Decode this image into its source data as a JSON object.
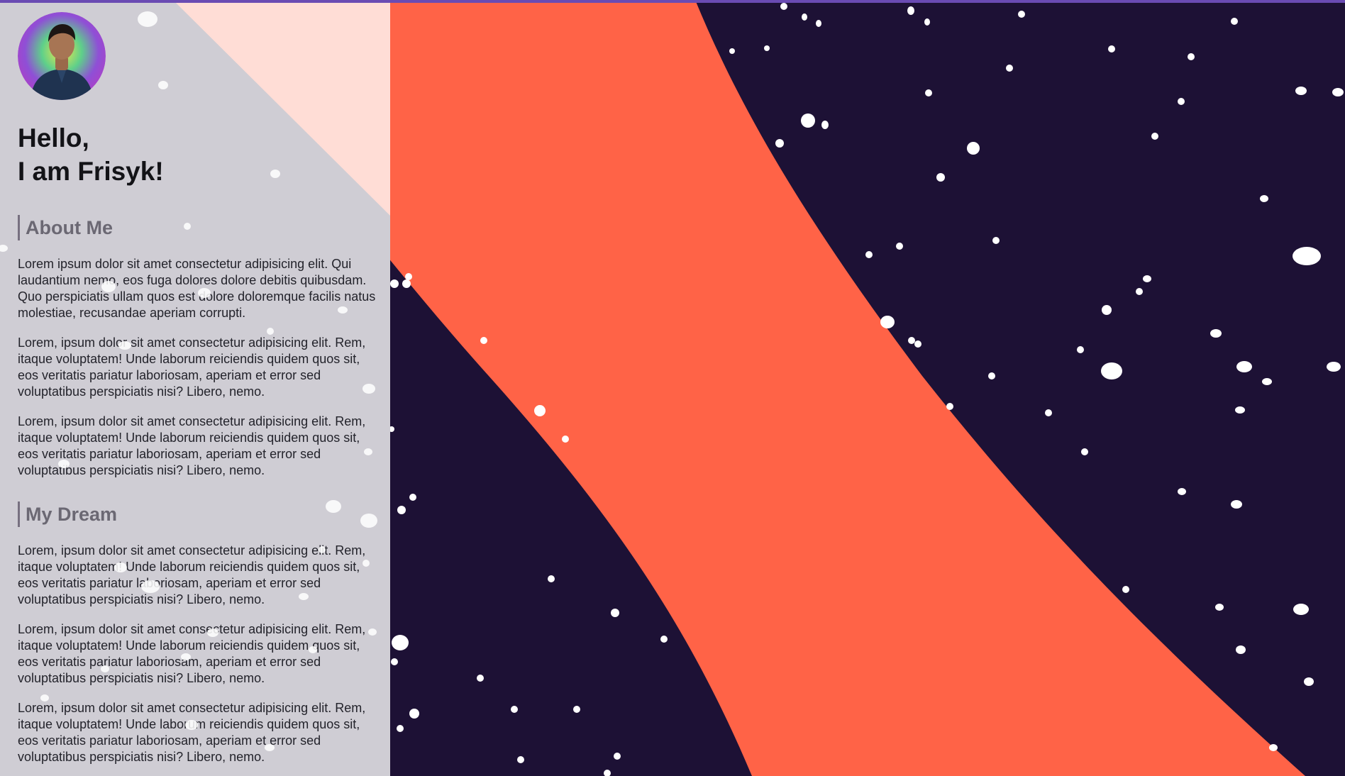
{
  "profile": {
    "greeting_line1": "Hello,",
    "greeting_line2": "I am Frisyk!"
  },
  "sections": [
    {
      "heading": "About Me",
      "paragraphs": [
        "Lorem ipsum dolor sit amet consectetur adipisicing elit. Qui laudantium nemo, eos fuga dolores dolore debitis quibusdam. Quo perspiciatis ullam quos est dolore doloremque facilis natus molestiae, recusandae aperiam corrupti.",
        "Lorem, ipsum dolor sit amet consectetur adipisicing elit. Rem, itaque voluptatem! Unde laborum reiciendis quidem quos sit, eos veritatis pariatur laboriosam, aperiam et error sed voluptatibus perspiciatis nisi? Libero, nemo.",
        "Lorem, ipsum dolor sit amet consectetur adipisicing elit. Rem, itaque voluptatem! Unde laborum reiciendis quidem quos sit, eos veritatis pariatur laboriosam, aperiam et error sed voluptatibus perspiciatis nisi? Libero, nemo."
      ]
    },
    {
      "heading": "My Dream",
      "paragraphs": [
        "Lorem, ipsum dolor sit amet consectetur adipisicing elit. Rem, itaque voluptatem! Unde laborum reiciendis quidem quos sit, eos veritatis pariatur laboriosam, aperiam et error sed voluptatibus perspiciatis nisi? Libero, nemo.",
        "Lorem, ipsum dolor sit amet consectetur adipisicing elit. Rem, itaque voluptatem! Unde laborum reiciendis quidem quos sit, eos veritatis pariatur laboriosam, aperiam et error sed voluptatibus perspiciatis nisi? Libero, nemo.",
        "Lorem, ipsum dolor sit amet consectetur adipisicing elit. Rem, itaque voluptatem! Unde laborum reiciendis quidem quos sit, eos veritatis pariatur laboriosam, aperiam et error sed voluptatibus perspiciatis nisi? Libero, nemo."
      ]
    }
  ],
  "theme": {
    "background_navy": "#1d1135",
    "accent_orange": "#ff6347",
    "panel_grey": "#cfcdd4",
    "panel_peach": "#ffddd6",
    "top_strip_purple": "#6a4bb3",
    "snow_white": "#ffffff"
  }
}
